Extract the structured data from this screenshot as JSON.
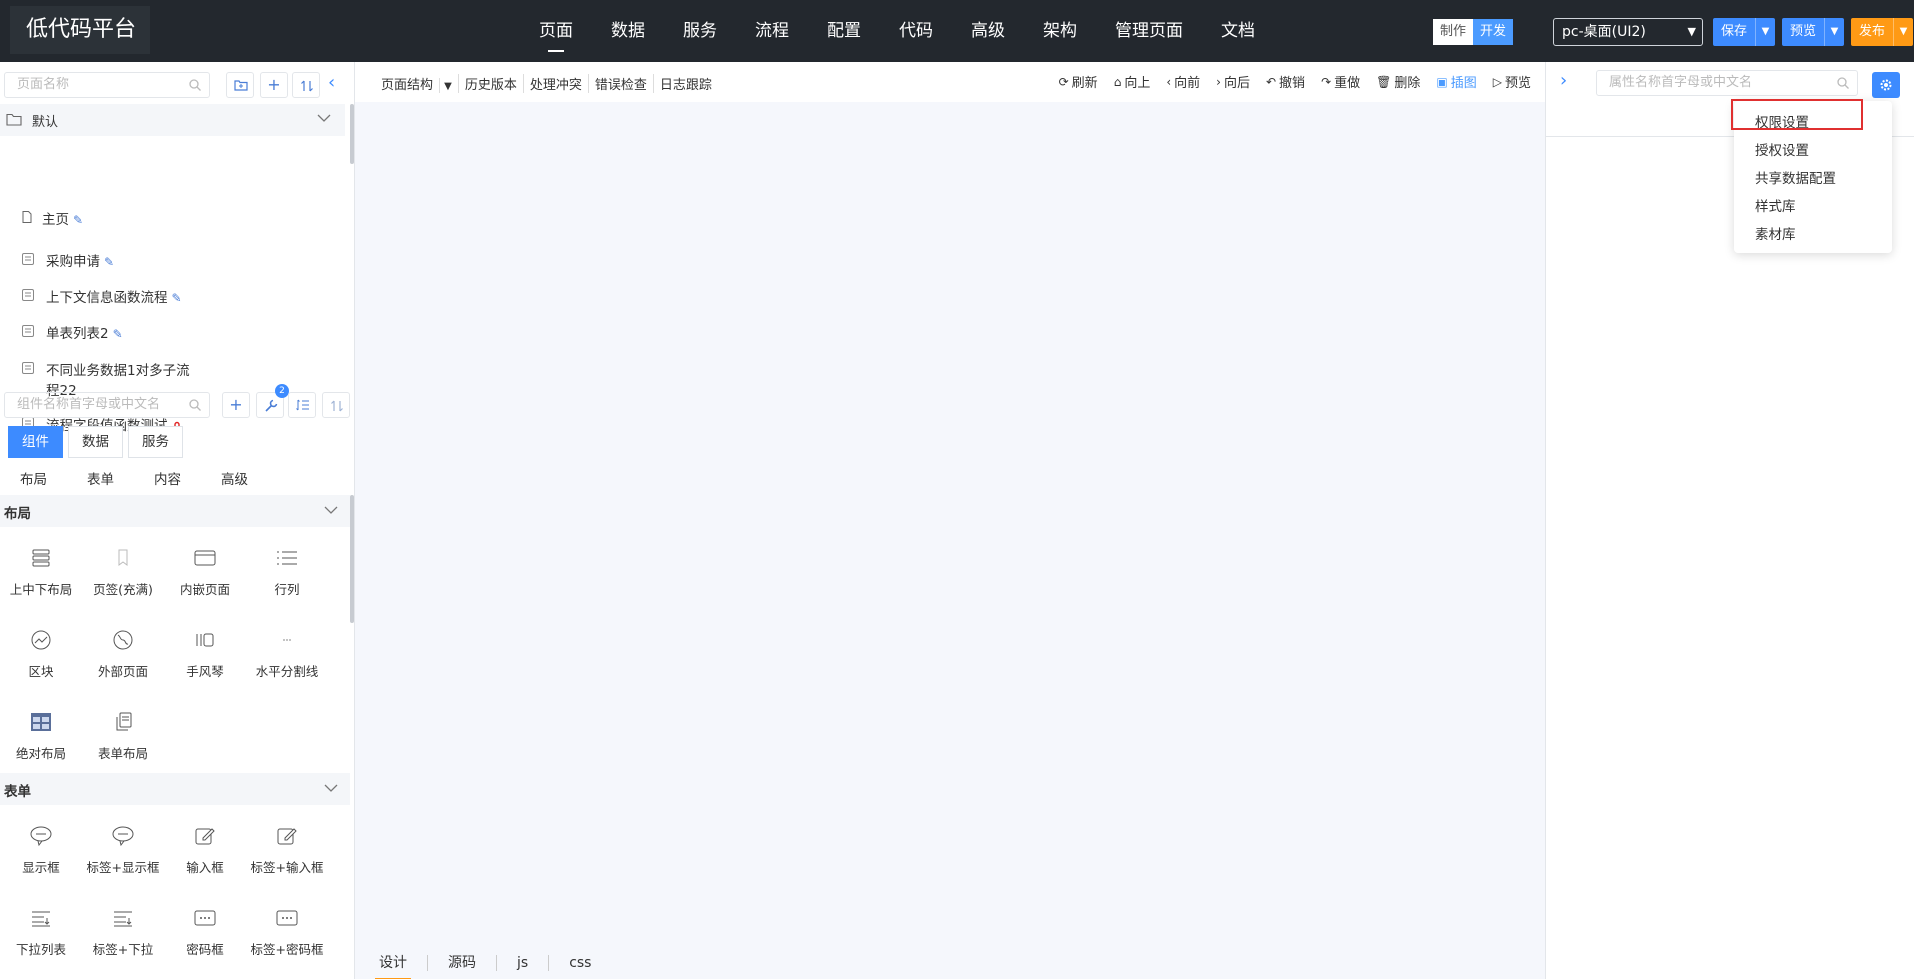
{
  "app": {
    "title": "低代码平台"
  },
  "topnav": [
    {
      "label": "页面",
      "active": true
    },
    {
      "label": "数据"
    },
    {
      "label": "服务"
    },
    {
      "label": "流程"
    },
    {
      "label": "配置"
    },
    {
      "label": "代码"
    },
    {
      "label": "高级"
    },
    {
      "label": "架构"
    },
    {
      "label": "管理页面"
    },
    {
      "label": "文档"
    }
  ],
  "mode": {
    "make": "制作",
    "dev": "开发",
    "active": "开发"
  },
  "env": {
    "selected": "pc-桌面(UI2)"
  },
  "actions": {
    "save": "保存",
    "preview": "预览",
    "publish": "发布"
  },
  "left": {
    "page_search_placeholder": "页面名称",
    "tree_root": "默认",
    "pages": [
      {
        "label": "主页",
        "editable": true
      },
      {
        "label": "采购申请",
        "editable": true
      },
      {
        "label": "上下文信息函数流程",
        "editable": true
      },
      {
        "label": "单表列表2",
        "editable": true
      },
      {
        "label": "不同业务数据1对多子流",
        "label2": "程22"
      },
      {
        "label": "流程字段值函数测试",
        "locked": true
      }
    ],
    "comp_search_placeholder": "组件名称首字母或中文名",
    "badge_count": "2",
    "tabs": [
      "组件",
      "数据",
      "服务"
    ],
    "active_tab": "组件",
    "subtabs": [
      "布局",
      "表单",
      "内容",
      "高级"
    ],
    "sections": {
      "layout": {
        "title": "布局",
        "items": [
          "上中下布局",
          "页签(充满)",
          "内嵌页面",
          "行列",
          "区块",
          "外部页面",
          "手风琴",
          "水平分割线",
          "绝对布局",
          "表单布局"
        ]
      },
      "form": {
        "title": "表单",
        "items": [
          "显示框",
          "标签+显示框",
          "输入框",
          "标签+输入框",
          "下拉列表",
          "标签+下拉",
          "密码框",
          "标签+密码框"
        ]
      }
    }
  },
  "center": {
    "toolbar_left": [
      "页面结构",
      "历史版本",
      "处理冲突",
      "错误检查",
      "日志跟踪"
    ],
    "toolbar_right": [
      {
        "label": "刷新",
        "icon": "refresh-icon"
      },
      {
        "label": "向上",
        "icon": "home-icon"
      },
      {
        "label": "向前",
        "icon": "chevron-left-icon"
      },
      {
        "label": "向后",
        "icon": "chevron-right-icon"
      },
      {
        "label": "撤销",
        "icon": "undo-icon"
      },
      {
        "label": "重做",
        "icon": "redo-icon"
      },
      {
        "label": "删除",
        "icon": "trash-icon"
      },
      {
        "label": "插图",
        "icon": "image-icon",
        "active": true
      },
      {
        "label": "预览",
        "icon": "play-icon"
      }
    ],
    "bottom_tabs": [
      "设计",
      "源码",
      "js",
      "css"
    ],
    "active_bottom": "设计"
  },
  "right": {
    "search_placeholder": "属性名称首字母或中文名",
    "menu": [
      "权限设置",
      "授权设置",
      "共享数据配置",
      "样式库",
      "素材库"
    ],
    "highlighted_menu": "权限设置"
  },
  "colors": {
    "accent": "#3d8bff",
    "orange": "#ff9a15",
    "topbar": "#23282e",
    "highlight": "#e03030"
  }
}
